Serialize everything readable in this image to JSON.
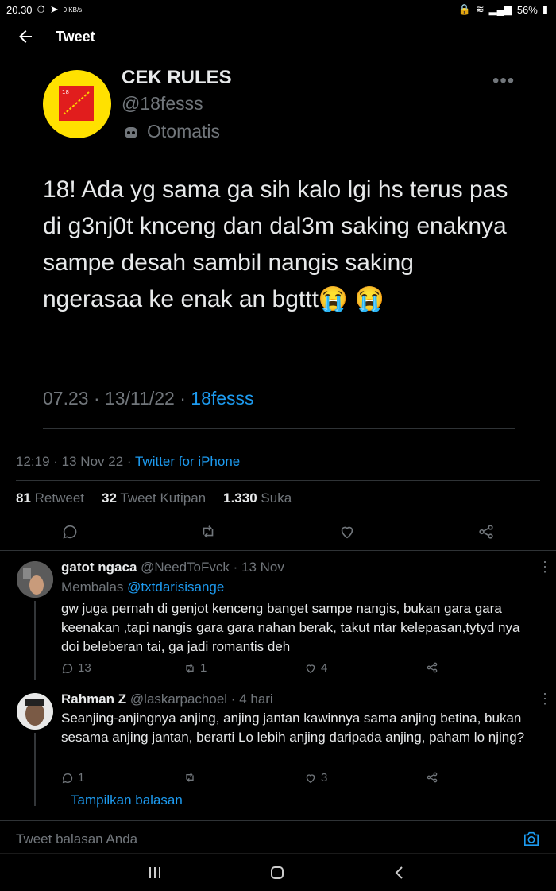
{
  "status_bar": {
    "time": "20.30",
    "net_speed": "0 KB/s",
    "battery": "56%"
  },
  "header": {
    "title": "Tweet"
  },
  "quoted_tweet": {
    "name": "CEK RULES",
    "handle": "@18fesss",
    "label": "Otomatis",
    "text": "18! Ada yg sama ga sih kalo lgi hs terus pas di g3nj0t knceng dan dal3m saking enaknya sampe desah sambil nangis  saking ngerasaa ke enak an bgttt😭 😭",
    "time": "07.23",
    "date": "13/11/22",
    "source": "18fesss"
  },
  "tweet_meta": {
    "time": "12:19",
    "date": "13 Nov 22",
    "client": "Twitter for iPhone"
  },
  "stats": {
    "retweets": "81",
    "retweets_label": "Retweet",
    "quotes": "32",
    "quotes_label": "Tweet Kutipan",
    "likes": "1.330",
    "likes_label": "Suka"
  },
  "replies": [
    {
      "name": "gatot ngaca",
      "handle": "@NeedToFvck",
      "time": "13 Nov",
      "replying_label": "Membalas",
      "replying_to": "@txtdarisisange",
      "text": "gw juga pernah di genjot kenceng banget sampe nangis, bukan gara gara keenakan ,tapi nangis gara gara nahan berak, takut ntar kelepasan,tytyd nya doi beleberan tai, ga jadi romantis deh",
      "replies": "13",
      "retweets": "1",
      "likes": "4"
    },
    {
      "name": "Rahman Z",
      "handle": "@laskarpachoel",
      "time": "4 hari",
      "text": "Seanjing-anjingnya anjing, anjing jantan kawinnya sama anjing betina, bukan sesama anjing jantan, berarti Lo lebih anjing daripada anjing, paham lo njing?",
      "replies": "1",
      "retweets": "",
      "likes": "3"
    }
  ],
  "show_replies": "Tampilkan balasan",
  "reply_input": {
    "placeholder": "Tweet balasan Anda"
  },
  "colors": {
    "accent": "#1d9bf0",
    "background": "#000000",
    "muted": "#71767b"
  }
}
